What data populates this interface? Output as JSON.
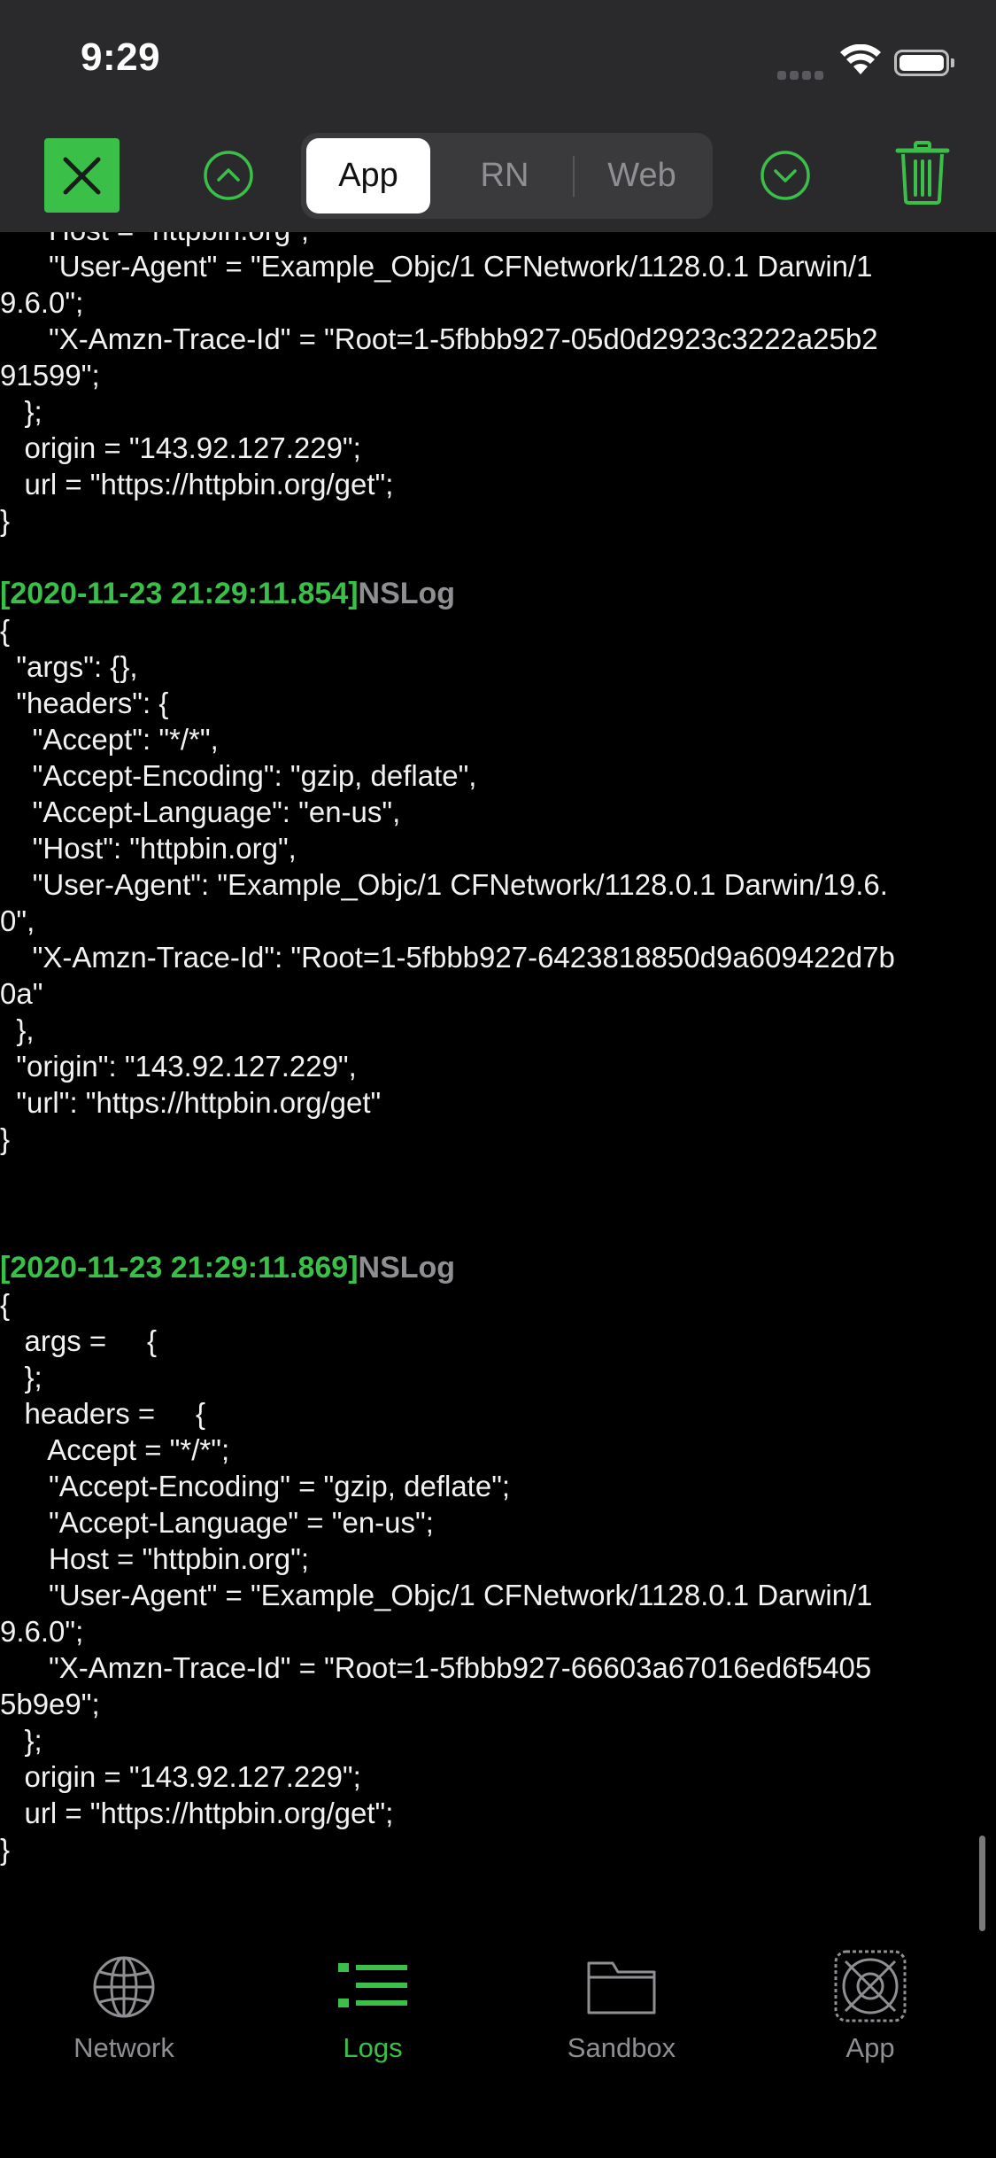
{
  "status_bar": {
    "time": "9:29"
  },
  "toolbar": {
    "segments": [
      "App",
      "RN",
      "Web"
    ],
    "active_segment": "App"
  },
  "colors": {
    "accent": "#3ac048",
    "toolbar_bg": "#2a2a2c",
    "muted": "#8f8f93"
  },
  "log": {
    "lines": [
      "      Host = \"httpbin.org\";",
      "      \"User-Agent\" = \"Example_Objc/1 CFNetwork/1128.0.1 Darwin/1",
      "9.6.0\";",
      "      \"X-Amzn-Trace-Id\" = \"Root=1-5fbbb927-05d0d2923c3222a25b2",
      "91599\";",
      "   };",
      "   origin = \"143.92.127.229\";",
      "   url = \"https://httpbin.org/get\";",
      "}",
      "{",
      "  \"args\": {},",
      "  \"headers\": {",
      "    \"Accept\": \"*/*\",",
      "    \"Accept-Encoding\": \"gzip, deflate\",",
      "    \"Accept-Language\": \"en-us\",",
      "    \"Host\": \"httpbin.org\",",
      "    \"User-Agent\": \"Example_Objc/1 CFNetwork/1128.0.1 Darwin/19.6.",
      "0\",",
      "    \"X-Amzn-Trace-Id\": \"Root=1-5fbbb927-6423818850d9a609422d7b",
      "0a\"",
      "  },",
      "  \"origin\": \"143.92.127.229\",",
      "  \"url\": \"https://httpbin.org/get\"",
      "}",
      "{",
      "   args =     {",
      "   };",
      "   headers =     {",
      "      Accept = \"*/*\";",
      "      \"Accept-Encoding\" = \"gzip, deflate\";",
      "      \"Accept-Language\" = \"en-us\";",
      "      Host = \"httpbin.org\";",
      "      \"User-Agent\" = \"Example_Objc/1 CFNetwork/1128.0.1 Darwin/1",
      "9.6.0\";",
      "      \"X-Amzn-Trace-Id\" = \"Root=1-5fbbb927-66603a67016ed6f5405",
      "5b9e9\";",
      "   };",
      "   origin = \"143.92.127.229\";",
      "   url = \"https://httpbin.org/get\";",
      "}"
    ],
    "entries": [
      {
        "timestamp": "[2020-11-23 21:29:11.854]",
        "tag": "NSLog"
      },
      {
        "timestamp": "[2020-11-23 21:29:11.869]",
        "tag": "NSLog"
      }
    ]
  },
  "tabbar": {
    "tabs": [
      {
        "label": "Network",
        "icon": "globe-icon"
      },
      {
        "label": "Logs",
        "icon": "list-icon"
      },
      {
        "label": "Sandbox",
        "icon": "folder-icon"
      },
      {
        "label": "App",
        "icon": "app-icon"
      }
    ],
    "active_tab": "Logs"
  }
}
